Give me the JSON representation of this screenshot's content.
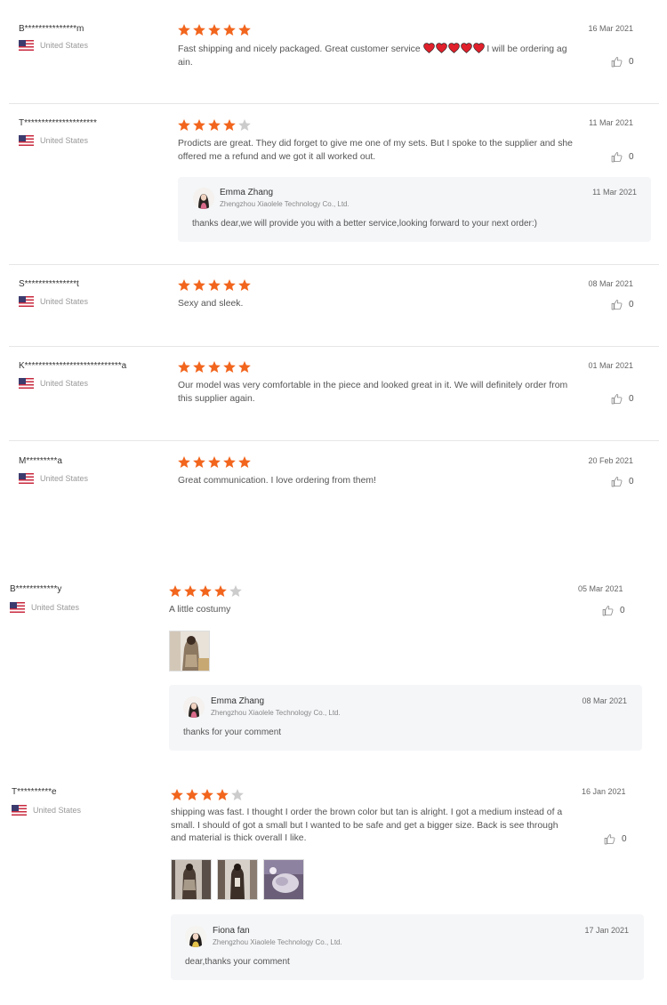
{
  "reviews": [
    {
      "buyer": "B***************m",
      "country": "United States",
      "rating": 5,
      "text": "Fast shipping and nicely packaged. Great customer service",
      "text_after": " I will be ordering again.",
      "hearts": 5,
      "date": "16 Mar 2021",
      "helpful": "0"
    },
    {
      "buyer": "T*********************",
      "country": "United States",
      "rating": 4,
      "text": "Prodicts are great. They did forget to give me one of my sets. But I spoke to the supplier and she offered me a refund and we got it all worked out.",
      "date": "11 Mar 2021",
      "helpful": "0",
      "reply": {
        "name": "Emma Zhang",
        "company": "Zhengzhou Xiaolele Technology Co., Ltd.",
        "date": "11 Mar 2021",
        "text": "thanks dear,we will provide you with a better service,looking forward to your next order:)"
      }
    },
    {
      "buyer": "S***************t",
      "country": "United States",
      "rating": 5,
      "text": "Sexy and sleek.",
      "date": "08 Mar 2021",
      "helpful": "0"
    },
    {
      "buyer": "K****************************a",
      "country": "United States",
      "rating": 5,
      "text": "Our model was very comfortable in the piece and looked great in it. We will definitely order from this supplier again.",
      "date": "01 Mar 2021",
      "helpful": "0"
    },
    {
      "buyer": "M*********a",
      "country": "United States",
      "rating": 5,
      "text": "Great communication. I love ordering from them!",
      "date": "20 Feb 2021",
      "helpful": "0"
    },
    {
      "buyer": "B************y",
      "country": "United States",
      "rating": 4,
      "text": "A little costumy",
      "date": "05 Mar 2021",
      "helpful": "0",
      "reply": {
        "name": "Emma Zhang",
        "company": "Zhengzhou Xiaolele Technology Co., Ltd.",
        "date": "08 Mar 2021",
        "text": "thanks for your comment"
      }
    },
    {
      "buyer": "T**********e",
      "country": "United States",
      "rating": 4,
      "text": "shipping was fast. I thought I order the brown color but tan is alright. I got a medium instead of a small. I should of got a small but I wanted to be safe and get a bigger size. Back is see through and material is thick overall I like.",
      "date": "16 Jan 2021",
      "helpful": "0",
      "reply": {
        "name": "Fiona fan",
        "company": "Zhengzhou Xiaolele Technology Co., Ltd.",
        "date": "17 Jan 2021",
        "text": "dear,thanks your comment"
      }
    }
  ],
  "colors": {
    "star_filled": "#f2651d",
    "star_empty": "#cccccc",
    "heart": "#e0212c",
    "reply_bg": "#f5f6f8"
  },
  "icons": {
    "star": "star-icon",
    "thumb": "thumbs-up-icon",
    "flag": "us-flag-icon",
    "heart": "heart-icon"
  }
}
